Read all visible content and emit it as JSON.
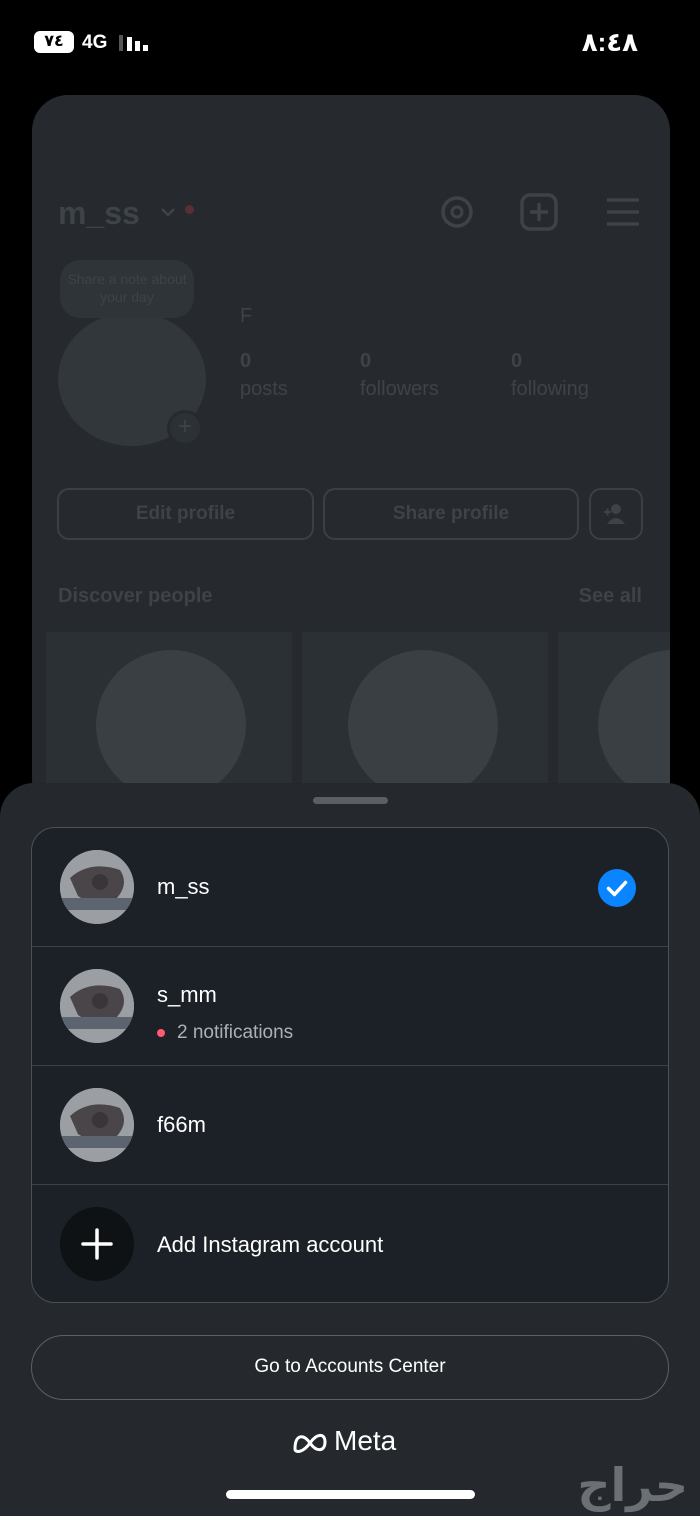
{
  "status_bar": {
    "battery": "٧٤",
    "network": "4G",
    "time": "٨:٤٨"
  },
  "background_profile": {
    "username": "m_ss",
    "note": "Share a note about your day",
    "display_name": "F",
    "stats": [
      {
        "value": "0",
        "label": "posts"
      },
      {
        "value": "0",
        "label": "followers"
      },
      {
        "value": "0",
        "label": "following"
      }
    ],
    "edit_profile": "Edit profile",
    "share_profile": "Share profile",
    "discover_people": "Discover people",
    "see_all": "See all"
  },
  "account_switcher": {
    "accounts": [
      {
        "username": "m_ss",
        "selected": true,
        "subtitle": ""
      },
      {
        "username": "s_mm",
        "selected": false,
        "subtitle": "2 notifications"
      },
      {
        "username": "f66m",
        "selected": false,
        "subtitle": ""
      }
    ],
    "add_account": "Add Instagram account",
    "accounts_center": "Go to Accounts Center",
    "brand": "Meta"
  },
  "watermark": "حراج",
  "colors": {
    "accent_blue": "#0a84ff",
    "notification_red": "#ff5a6e",
    "sheet_bg": "#25292d",
    "list_bg": "#1b2126"
  }
}
